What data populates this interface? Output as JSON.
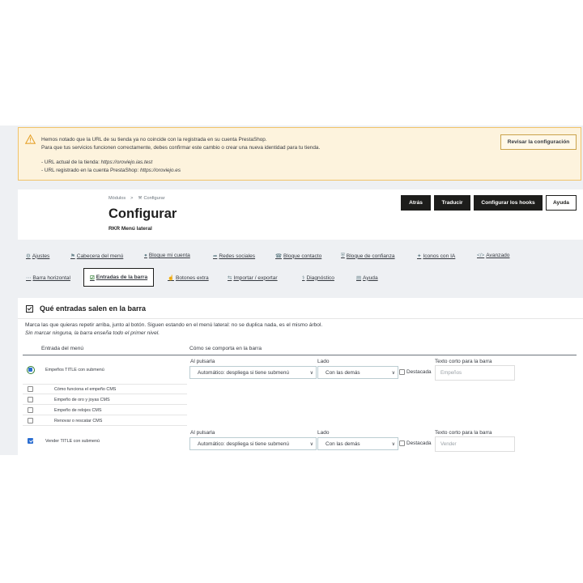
{
  "alert": {
    "line1": "Hemos notado que la URL de su tienda ya no coincide con la registrada en su cuenta PrestaShop.",
    "line2": "Para que tus servicios funcionen correctamente, debes confirmar este cambio o crear una nueva identidad para tu tienda.",
    "line3_label": "- URL actual de la tienda: ",
    "line3_url": "https://oroviejo.ias.test",
    "line4_label": "- URL registrado en la cuenta PrestaShop: ",
    "line4_url": "https://oroviejo.es",
    "button": "Revisar la configuración"
  },
  "header": {
    "breadcrumb": [
      "Módulos",
      ">",
      "Configurar"
    ],
    "title": "Configurar",
    "subtitle": "RKR Menú lateral",
    "buttons": [
      "Atrás",
      "Traducir",
      "Configurar los hooks",
      "Ayuda"
    ]
  },
  "tabs_row1": [
    "Ajustes",
    "Cabecera del menú",
    "Bloque mi cuenta",
    "Redes sociales",
    "Bloque contacto",
    "Bloque de confianza",
    "Iconos con IA",
    "Avanzado"
  ],
  "tabs_row2": [
    "Barra horizontal",
    "Entradas de la barra",
    "Botones extra",
    "Importar / exportar",
    "Diagnóstico",
    "Ayuda"
  ],
  "card": {
    "title": "Qué entradas salen en la barra",
    "intro1": "Marca las que quieras repetir arriba, junto al botón. Siguen estando en el menú lateral: no se duplica nada, es el mismo árbol.",
    "intro2": "Sin marcar ninguna, la barra enseña todo el primer nivel.",
    "col1": "Entrada del menú",
    "col2": "Cómo se comporta en la barra",
    "rows": [
      {
        "label": "Empeños TITLE con submenú",
        "checked": true,
        "al_pulsarla": "Al pulsarla",
        "al_value": "Automático: despliega si tiene submenú",
        "lado": "Lado",
        "lado_value": "Con las demás",
        "destacada": "Destacada",
        "texto": "Texto corto para la barra",
        "placeholder": "Empeños"
      },
      {
        "label": "Vender TITLE con submenú",
        "checked": true,
        "al_pulsarla": "Al pulsarla",
        "al_value": "Automático: despliega si tiene submenú",
        "lado": "Lado",
        "lado_value": "Con las demás",
        "destacada": "Destacada",
        "texto": "Texto corto para la barra",
        "placeholder": "Vender"
      }
    ],
    "subitems": [
      "Cómo funciona el empeño CMS",
      "Empeño de oro y joyas CMS",
      "Empeño de relojes CMS",
      "Renovar o rescatar CMS"
    ]
  },
  "colors": {
    "accent": "#25b9d7",
    "warning_bg": "#fdf3dd",
    "warning_border": "#f0c36a",
    "dark_button": "#1d1d1b",
    "check_blue": "#2b6ed1"
  }
}
